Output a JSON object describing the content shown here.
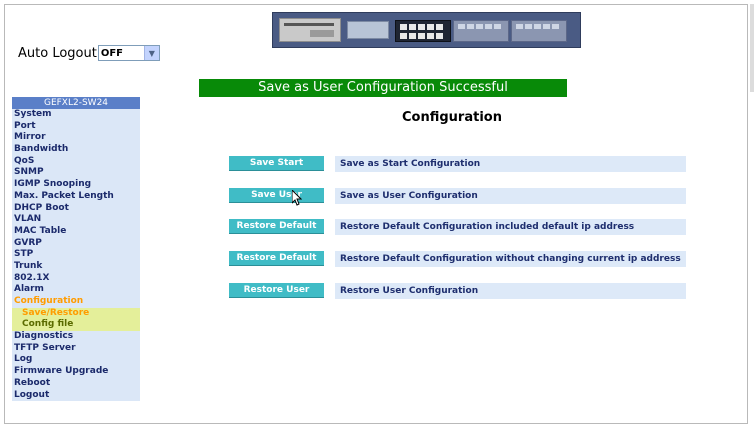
{
  "auto_logout": {
    "label": "Auto Logout",
    "selected": "OFF"
  },
  "banner": {
    "text": "Save as User Configuration Successful"
  },
  "sidebar": {
    "title": "GEFXL2-SW24",
    "items": [
      {
        "label": "System"
      },
      {
        "label": "Port"
      },
      {
        "label": "Mirror"
      },
      {
        "label": "Bandwidth"
      },
      {
        "label": "QoS"
      },
      {
        "label": "SNMP"
      },
      {
        "label": "IGMP Snooping"
      },
      {
        "label": "Max. Packet Length"
      },
      {
        "label": "DHCP Boot"
      },
      {
        "label": "VLAN"
      },
      {
        "label": "MAC Table"
      },
      {
        "label": "GVRP"
      },
      {
        "label": "STP"
      },
      {
        "label": "Trunk"
      },
      {
        "label": "802.1X"
      },
      {
        "label": "Alarm"
      },
      {
        "label": "Configuration"
      },
      {
        "label": "Save/Restore"
      },
      {
        "label": "Config file"
      },
      {
        "label": "Diagnostics"
      },
      {
        "label": "TFTP Server"
      },
      {
        "label": "Log"
      },
      {
        "label": "Firmware Upgrade"
      },
      {
        "label": "Reboot"
      },
      {
        "label": "Logout"
      }
    ]
  },
  "main": {
    "title": "Configuration",
    "rows": [
      {
        "button": "Save Start",
        "description": "Save as Start Configuration"
      },
      {
        "button": "Save User",
        "description": "Save as User Configuration"
      },
      {
        "button": "Restore Default",
        "description": "Restore Default Configuration included default ip address"
      },
      {
        "button": "Restore Default",
        "description": "Restore Default Configuration without changing current ip address"
      },
      {
        "button": "Restore User",
        "description": "Restore User Configuration"
      }
    ]
  },
  "colors": {
    "banner": "#088a08",
    "button": "#40bcc6",
    "sidebar_header": "#5a7fc8",
    "sidebar_bg": "#dbe7f7",
    "active_item": "#ff9c00",
    "subitem_bg": "#e4ef9a"
  },
  "icons": {
    "select_arrow": "chevron-down-icon",
    "cursor": "mouse-pointer-icon"
  }
}
